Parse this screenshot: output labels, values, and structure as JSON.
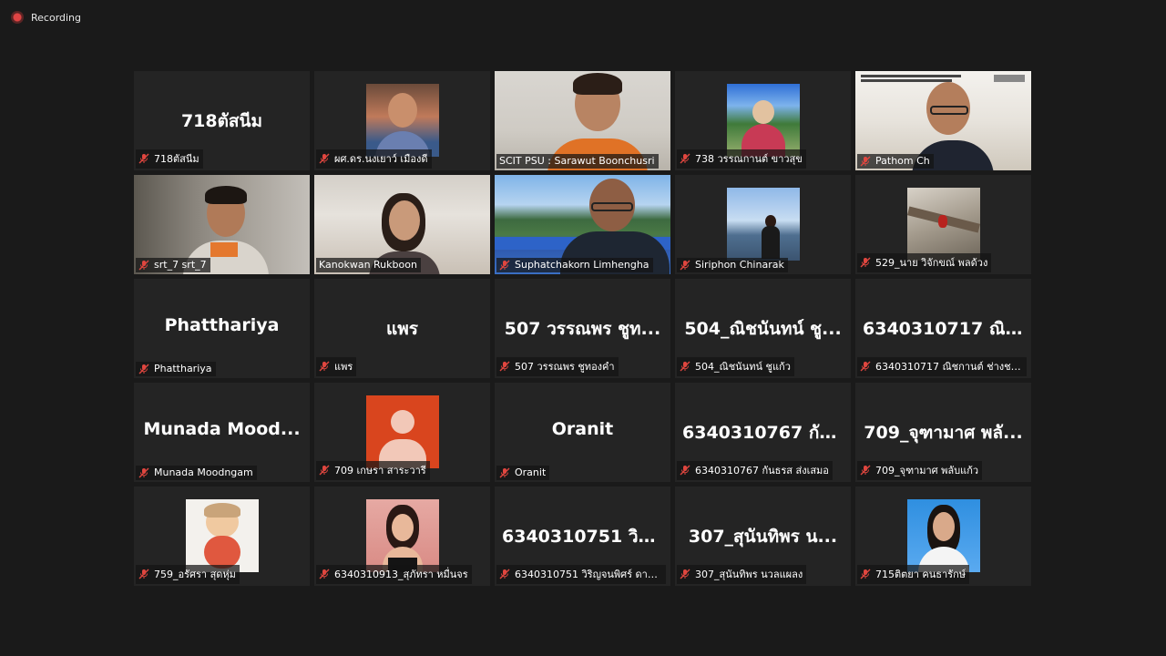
{
  "recording": {
    "label": "Recording"
  },
  "participants": [
    {
      "name": "718ตัสนีม",
      "big": "718ตัสนีม"
    },
    {
      "name": "ผศ.ดร.นงเยาว์ เมืองดี"
    },
    {
      "name": "SCIT PSU : Sarawut Boonchusri"
    },
    {
      "name": "738 วรรณกานต์ ขาวสุข"
    },
    {
      "name": "Pathom Ch"
    },
    {
      "name": "srt_7 srt_7"
    },
    {
      "name": "Kanokwan Rukboon"
    },
    {
      "name": "Suphatchakorn Limhengha"
    },
    {
      "name": "Siriphon Chinarak"
    },
    {
      "name": "529_นาย วิจักขณ์ พลด้วง"
    },
    {
      "name": "Phatthariya",
      "big": "Phatthariya"
    },
    {
      "name": "แพร",
      "big": "แพร"
    },
    {
      "name": "507 วรรณพร ชูทองคำ",
      "big": "507 วรรณพร ชูท..."
    },
    {
      "name": "504_ณิชนันทน์ ชูแก้ว",
      "big": "504_ณิชนันทน์ ชู..."
    },
    {
      "name": "6340310717 ณิชกานต์ ช่างชนะ",
      "big": "6340310717 ณิ..."
    },
    {
      "name": "Munada Moodngam",
      "big": "Munada  Mood..."
    },
    {
      "name": "709 เกษรา สาระวารี"
    },
    {
      "name": "Oranit",
      "big": "Oranit"
    },
    {
      "name": "6340310767 กันธรส ส่งเสมอ",
      "big": "6340310767 กัน..."
    },
    {
      "name": "709_จุฑามาศ พลับแก้ว",
      "big": "709_จุฑามาศ พลั..."
    },
    {
      "name": "759_อรัศรา สุดหุ่ม"
    },
    {
      "name": "6340310913_สุภัทรา หมื่นจร"
    },
    {
      "name": "6340310751 วิริญจนพิศร์ ดาระ...",
      "big": "6340310751 วิวั..."
    },
    {
      "name": "307_สุนันทิพร นวลแผลง",
      "big": "307_สุนันทิพร น..."
    },
    {
      "name": "715ติตยา คนธารักษ์"
    }
  ],
  "colors": {
    "background": "#1a1a1a",
    "tile": "#242424",
    "active_speaker": "#dfe87a",
    "mute_icon": "#e0463f"
  }
}
